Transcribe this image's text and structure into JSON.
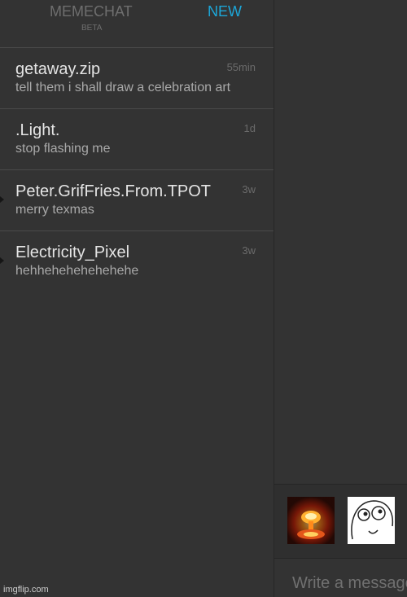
{
  "header": {
    "brand": "MEMECHAT",
    "beta": "BETA",
    "new_label": "NEW"
  },
  "conversations": [
    {
      "name": "getaway.zip",
      "preview": "tell them i shall draw a celebration art",
      "time": "55min",
      "unread": false
    },
    {
      "name": ".Light.",
      "preview": "stop flashing me",
      "time": "1d",
      "unread": false
    },
    {
      "name": "Peter.GrifFries.From.TPOT",
      "preview": "merry texmas",
      "time": "3w",
      "unread": true
    },
    {
      "name": "Electricity_Pixel",
      "preview": "hehhehehehehehehe",
      "time": "3w",
      "unread": true
    }
  ],
  "stickers": [
    {
      "name": "nuclear-explosion-sticker"
    },
    {
      "name": "derp-face-sticker"
    }
  ],
  "composer": {
    "placeholder": "Write a message"
  },
  "watermark": "imgflip.com",
  "colors": {
    "background": "#333333",
    "accent": "#1ca7d9"
  }
}
